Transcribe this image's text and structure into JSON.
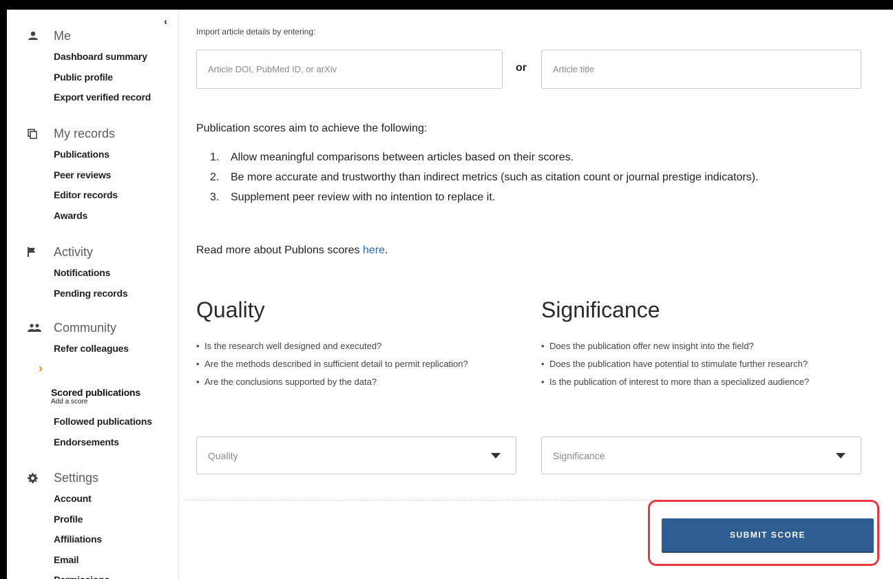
{
  "sidebar": {
    "collapse_glyph": "‹",
    "sections": [
      {
        "label": "Me",
        "icon": "person-icon",
        "items": [
          "Dashboard summary",
          "Public profile",
          "Export verified record"
        ]
      },
      {
        "label": "My records",
        "icon": "copy-icon",
        "items": [
          "Publications",
          "Peer reviews",
          "Editor records",
          "Awards"
        ]
      },
      {
        "label": "Activity",
        "icon": "flag-icon",
        "items": [
          "Notifications",
          "Pending records"
        ]
      },
      {
        "label": "Community",
        "icon": "people-icon",
        "items": [
          "Refer colleagues"
        ]
      },
      {
        "label": "Settings",
        "icon": "gear-icon",
        "items": [
          "Account",
          "Profile",
          "Affiliations",
          "Email",
          "Permissions"
        ]
      }
    ],
    "active_arrow": "›",
    "active_item": {
      "label": "Scored publications",
      "sub": "Add a score"
    },
    "after_active": [
      "Followed publications",
      "Endorsements"
    ]
  },
  "main": {
    "import_label": "Import article details by entering:",
    "doi_placeholder": "Article DOI, PubMed ID, or arXiv",
    "or_label": "or",
    "title_placeholder": "Article title",
    "intro": "Publication scores aim to achieve the following:",
    "aims": [
      {
        "num": "1.",
        "text": "Allow meaningful comparisons between articles based on their scores."
      },
      {
        "num": "2.",
        "text": "Be more accurate and trustworthy than indirect metrics (such as citation count or journal prestige indicators)."
      },
      {
        "num": "3.",
        "text": "Supplement peer review with no intention to replace it."
      }
    ],
    "read_more_prefix": "Read more about Publons scores ",
    "read_more_link": "here",
    "read_more_suffix": ".",
    "quality": {
      "heading": "Quality",
      "questions": [
        "Is the research well designed and executed?",
        "Are the methods described in sufficient detail to permit replication?",
        "Are the conclusions supported by the data?"
      ],
      "select_placeholder": "Quality"
    },
    "significance": {
      "heading": "Significance",
      "questions": [
        "Does the publication offer new insight into the field?",
        "Does the publication have potential to stimulate further research?",
        "Is the publication of interest to more than a specialized audience?"
      ],
      "select_placeholder": "Significance"
    },
    "submit_label": "SUBMIT SCORE",
    "highlight_color": "#e8383d",
    "button_color": "#2d5d91"
  }
}
